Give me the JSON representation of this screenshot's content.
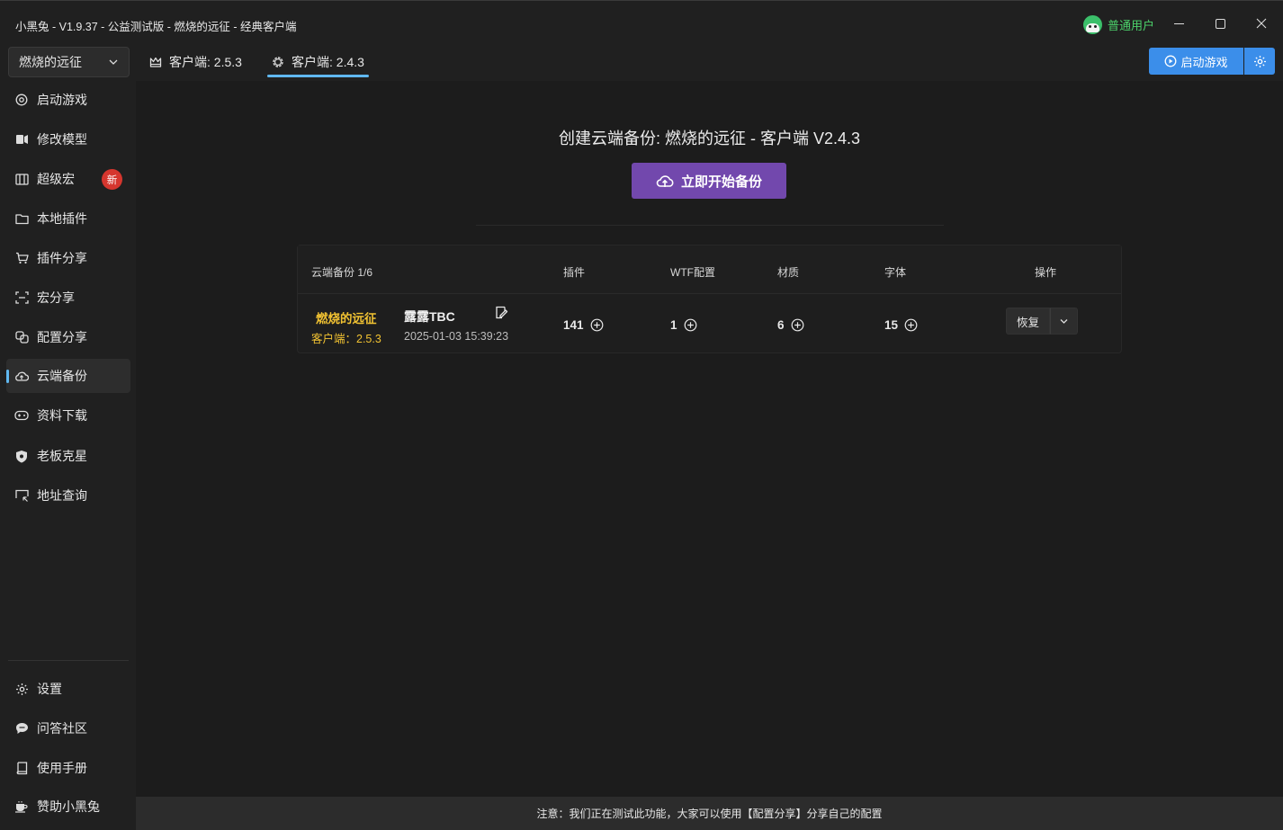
{
  "window": {
    "title": "小黑兔 - V1.9.37 - 公益测试版 - 燃烧的远征 - 经典客户端",
    "user_label": "普通用户"
  },
  "sidebar": {
    "game_select": "燃烧的远征",
    "items": [
      {
        "label": "启动游戏",
        "icon": "target-icon"
      },
      {
        "label": "修改模型",
        "icon": "model-icon"
      },
      {
        "label": "超级宏",
        "icon": "macro-icon",
        "badge": "新"
      },
      {
        "label": "本地插件",
        "icon": "folder-icon"
      },
      {
        "label": "插件分享",
        "icon": "cart-icon"
      },
      {
        "label": "宏分享",
        "icon": "scan-icon"
      },
      {
        "label": "配置分享",
        "icon": "link-icon"
      },
      {
        "label": "云端备份",
        "icon": "cloud-icon",
        "active": true
      },
      {
        "label": "资料下载",
        "icon": "gamepad-icon"
      },
      {
        "label": "老板克星",
        "icon": "shield-icon"
      },
      {
        "label": "地址查询",
        "icon": "screen-icon"
      }
    ],
    "bottom_items": [
      {
        "label": "设置",
        "icon": "gear-icon"
      },
      {
        "label": "问答社区",
        "icon": "chat-icon"
      },
      {
        "label": "使用手册",
        "icon": "book-icon"
      },
      {
        "label": "赞助小黑兔",
        "icon": "coffee-icon"
      }
    ]
  },
  "tabs": [
    {
      "label": "客户端: 2.5.3",
      "icon": "crown-icon"
    },
    {
      "label": "客户端: 2.4.3",
      "icon": "gear-icon",
      "active": true
    }
  ],
  "toolbar": {
    "start_label": "启动游戏"
  },
  "backup": {
    "title": "创建云端备份: 燃烧的远征 - 客户端 V2.4.3",
    "button_label": "立即开始备份"
  },
  "table": {
    "headers": {
      "backup": "云端备份 1/6",
      "addons": "插件",
      "wtf": "WTF配置",
      "materials": "材质",
      "fonts": "字体",
      "actions": "操作"
    },
    "rows": [
      {
        "game": "燃烧的远征",
        "client": "客户端：2.5.3",
        "name": "露露TBC",
        "date": "2025-01-03 15:39:23",
        "addons": "141",
        "wtf": "1",
        "materials": "6",
        "fonts": "15",
        "restore_label": "恢复"
      }
    ]
  },
  "footer": {
    "notice": "注意：我们正在测试此功能，大家可以使用【配置分享】分享自己的配置"
  },
  "colors": {
    "accent": "#60b8f0",
    "primary": "#3b8eea",
    "purple": "#7248ad",
    "gold": "#f1c232",
    "badge": "#d5362e"
  }
}
